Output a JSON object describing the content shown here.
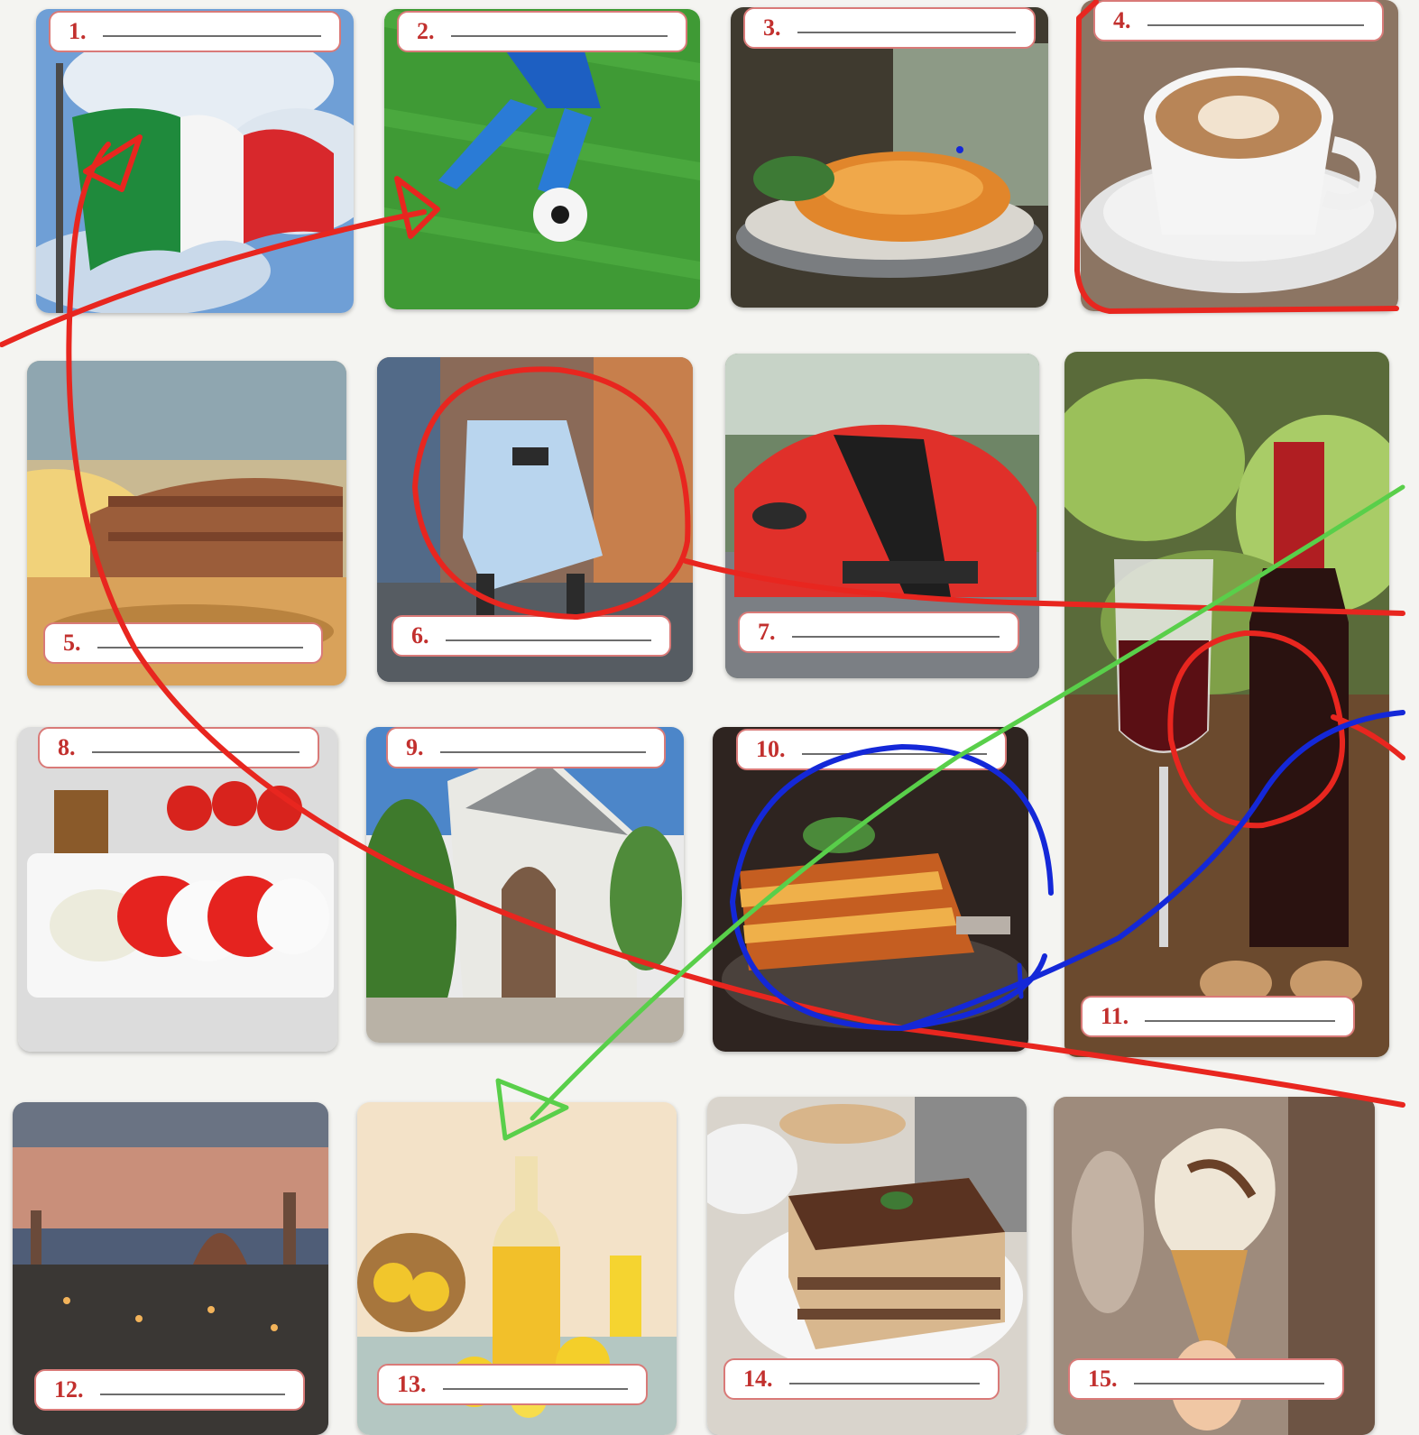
{
  "cards": [
    {
      "number": "1.",
      "subject": "italian-flag"
    },
    {
      "number": "2.",
      "subject": "football"
    },
    {
      "number": "3.",
      "subject": "spaghetti"
    },
    {
      "number": "4.",
      "subject": "cappuccino"
    },
    {
      "number": "5.",
      "subject": "colosseum"
    },
    {
      "number": "6.",
      "subject": "scooter"
    },
    {
      "number": "7.",
      "subject": "sports-car"
    },
    {
      "number": "8.",
      "subject": "caprese-salad"
    },
    {
      "number": "9.",
      "subject": "trulli-houses"
    },
    {
      "number": "10.",
      "subject": "lasagna"
    },
    {
      "number": "11.",
      "subject": "red-wine"
    },
    {
      "number": "12.",
      "subject": "florence-skyline"
    },
    {
      "number": "13.",
      "subject": "limoncello"
    },
    {
      "number": "14.",
      "subject": "tiramisu"
    },
    {
      "number": "15.",
      "subject": "gelato"
    }
  ],
  "annotation_colors": {
    "red": "#e8261f",
    "blue": "#1428d8",
    "green": "#59cf4a"
  }
}
